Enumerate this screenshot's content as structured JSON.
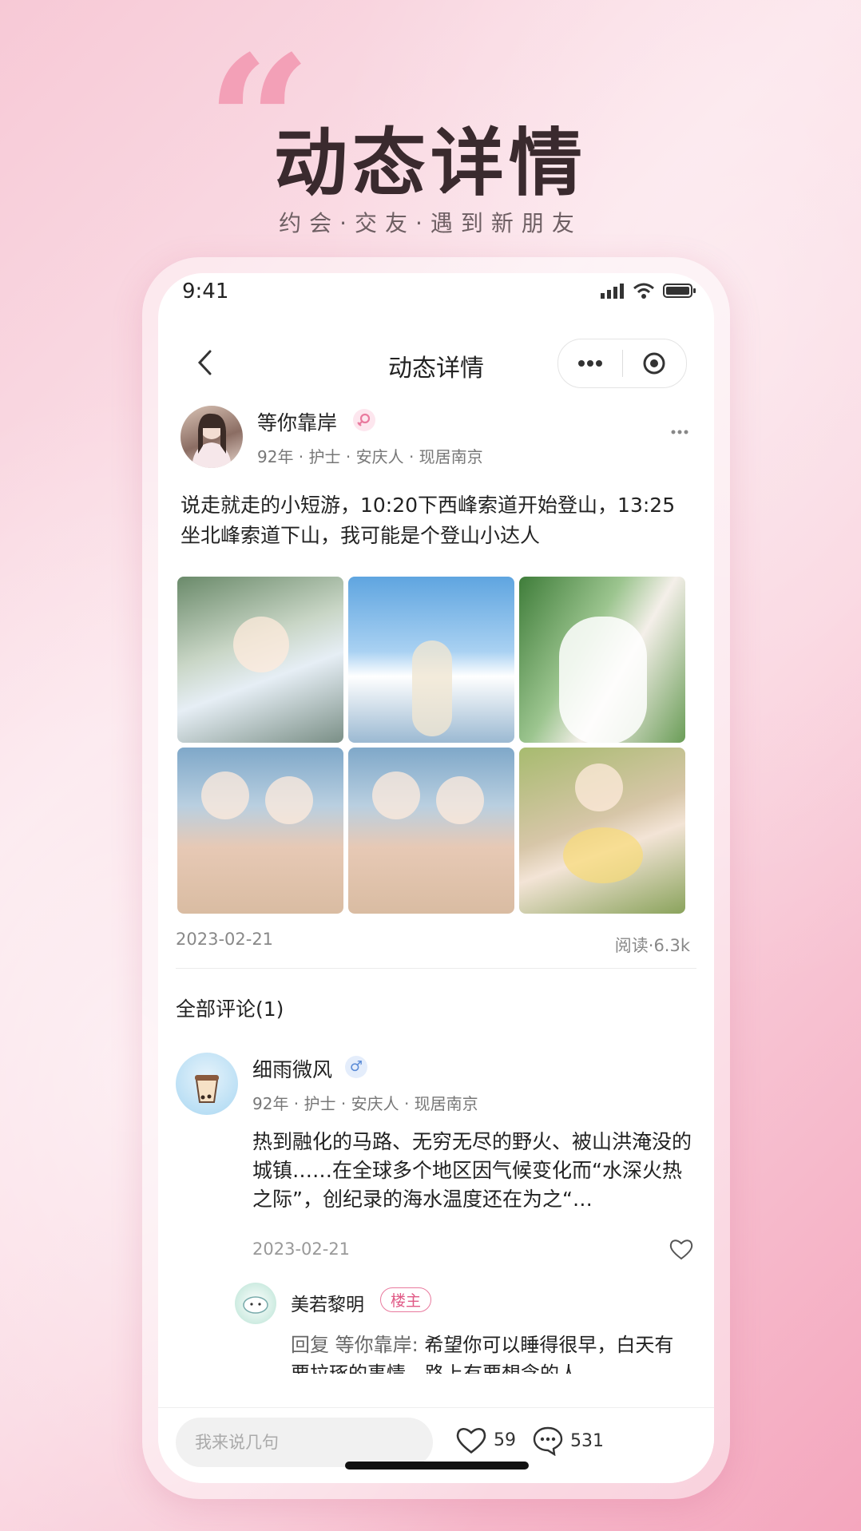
{
  "hero": {
    "quote_mark": "“",
    "title": "动态详情",
    "subtitle": "约会·交友·遇到新朋友"
  },
  "status_bar": {
    "time": "9:41"
  },
  "navbar": {
    "title": "动态详情",
    "back_icon": "chevron-left-icon"
  },
  "post": {
    "author_name": "等你靠岸",
    "author_gender": "female",
    "author_meta": "92年 · 护士 · 安庆人 · 现居南京",
    "text": "说走就走的小短游，10:20下西峰索道开始登山，13:25坐北峰索道下山，我可能是个登山小达人",
    "photo_count": 6,
    "date": "2023-02-21",
    "reads": "阅读·6.3k"
  },
  "comments": {
    "title": "全部评论(1)",
    "items": [
      {
        "name": "细雨微风",
        "gender_symbol": "♂",
        "meta": "92年 · 护士 · 安庆人 · 现居南京",
        "text": "热到融化的马路、无穷无尽的野火、被山洪淹没的城镇……在全球多个地区因气候变化而“水深火热之际”，创纪录的海水温度还在为之“…",
        "date": "2023-02-21",
        "reply": {
          "name": "美若黎明",
          "tag": "楼主",
          "prefix": "回复 等你靠岸:",
          "text": "希望你可以睡得很早，白天有要拉琢的事情，路上有要想念的人"
        }
      }
    ]
  },
  "bottom_bar": {
    "input_placeholder": "我来说几句",
    "like_count": "59",
    "comment_count": "531"
  },
  "colors": {
    "accent_pink": "#e05a86",
    "male_blue": "#5b8bd6"
  }
}
